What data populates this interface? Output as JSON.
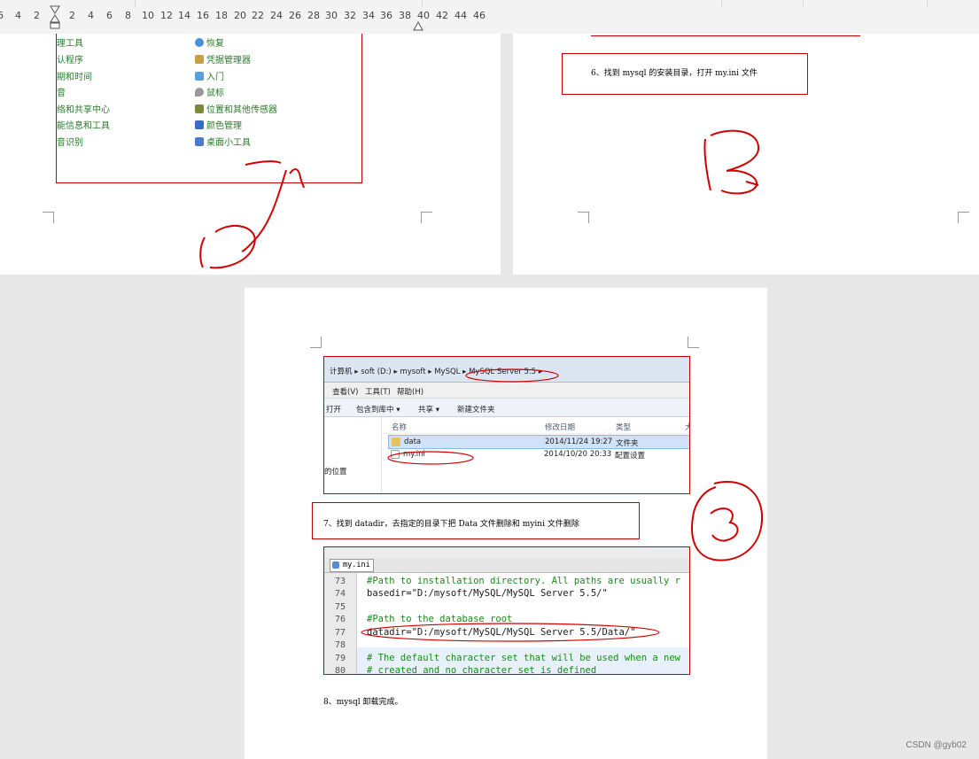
{
  "ruler": {
    "ticks": [
      "6",
      "4",
      "2",
      "2",
      "4",
      "6",
      "8",
      "10",
      "12",
      "14",
      "16",
      "18",
      "20",
      "22",
      "24",
      "26",
      "28",
      "30",
      "32",
      "34",
      "36",
      "38",
      "40",
      "42",
      "44",
      "46"
    ]
  },
  "page1": {
    "cp_left": [
      "理工具",
      "认程序",
      "期和时间",
      "音",
      "络和共享中心",
      "能信息和工具",
      "音识别"
    ],
    "cp_right": [
      {
        "label": "恢复",
        "icon": "restore-icon"
      },
      {
        "label": "凭据管理器",
        "icon": "credential-icon"
      },
      {
        "label": "入门",
        "icon": "getting-started-icon"
      },
      {
        "label": "鼠标",
        "icon": "mouse-icon"
      },
      {
        "label": "位置和其他传感器",
        "icon": "sensor-icon"
      },
      {
        "label": "颜色管理",
        "icon": "color-management-icon"
      },
      {
        "label": "桌面小工具",
        "icon": "gadgets-icon"
      }
    ]
  },
  "page2": {
    "step6": "6、找到 mysql 的安装目录，打开 my.ini 文件"
  },
  "page3": {
    "explorer": {
      "breadcrumb": [
        "计算机",
        "soft (D:)",
        "mysoft",
        "MySQL",
        "MySQL Server 5.5"
      ],
      "menu": [
        "查看(V)",
        "工具(T)",
        "帮助(H)"
      ],
      "toolbar": [
        "打开",
        "包含到库中 ▾",
        "共享 ▾",
        "新建文件夹"
      ],
      "columns": [
        "名称",
        "修改日期",
        "类型",
        "大"
      ],
      "sidebar_item": "的位置",
      "files": [
        {
          "name": "data",
          "date": "2014/11/24 19:27",
          "type": "文件夹"
        },
        {
          "name": "my.ini",
          "date": "2014/10/20 20:33",
          "type": "配置设置"
        }
      ]
    },
    "step7": "7、找到 datadir，去指定的目录下把 Data 文件删除和 myini 文件删除",
    "editor": {
      "tab": "my.ini",
      "lines": [
        {
          "n": "73",
          "text": "#Path to installation directory. All paths are usually r",
          "kind": "comment"
        },
        {
          "n": "74",
          "text": "basedir=\"D:/mysoft/MySQL/MySQL Server 5.5/\"",
          "kind": "code"
        },
        {
          "n": "75",
          "text": "",
          "kind": "code"
        },
        {
          "n": "76",
          "text": "#Path to the database root",
          "kind": "comment"
        },
        {
          "n": "77",
          "text": "datadir=\"D:/mysoft/MySQL/MySQL Server 5.5/Data/\"",
          "kind": "code"
        },
        {
          "n": "78",
          "text": "",
          "kind": "code"
        },
        {
          "n": "79",
          "text": "# The default character set that will be used when a new",
          "kind": "comment"
        },
        {
          "n": "80",
          "text": "# created and no character set is defined",
          "kind": "comment"
        }
      ]
    },
    "step8": "8、mysql 卸载完成。"
  },
  "watermark": "CSDN @gyb02",
  "colors": {
    "accent_red": "#c00000",
    "annotation_red": "#d00000",
    "link_green": "#2a7a2a"
  }
}
